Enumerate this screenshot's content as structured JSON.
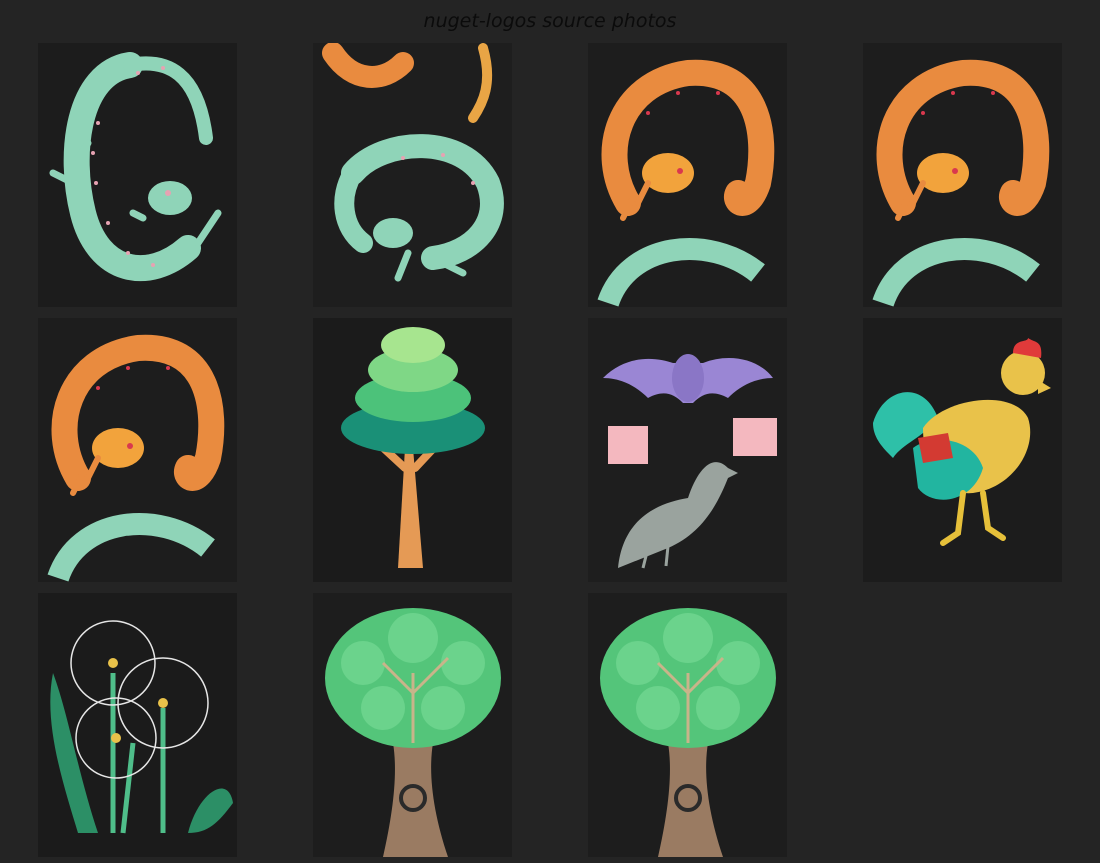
{
  "page": {
    "title": "nuget-logos source photos"
  },
  "colors": {
    "background": "#242424",
    "photo_bg": "#1a1a1a"
  },
  "photos": [
    {
      "subject": "mint gecko drawing"
    },
    {
      "subject": "orange and mint gecko drawing"
    },
    {
      "subject": "orange gecko drawing"
    },
    {
      "subject": "orange gecko drawing"
    },
    {
      "subject": "orange gecko drawing"
    },
    {
      "subject": "layered green tree drawing"
    },
    {
      "subject": "bat, squares and crow drawing"
    },
    {
      "subject": "rooster drawing"
    },
    {
      "subject": "dandelion drawing"
    },
    {
      "subject": "oak tree drawing"
    },
    {
      "subject": "oak tree drawing"
    }
  ]
}
